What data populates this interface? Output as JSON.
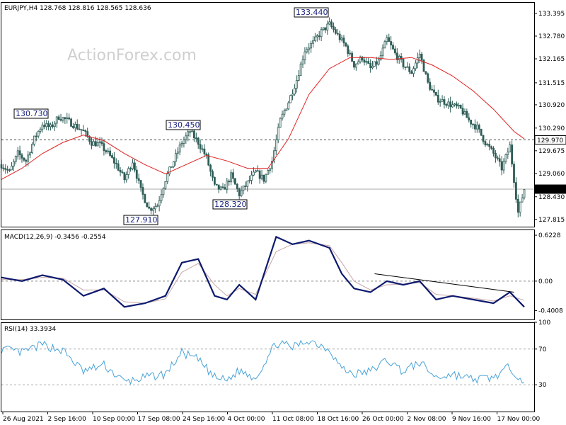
{
  "watermark": "ActionForex.com",
  "colors": {
    "candle": "#2e5d57",
    "ma": "#e02020",
    "macd": "#0d1a6e",
    "signal": "#c8a6a6",
    "rsi": "#4aa3d8",
    "trendline": "#000000",
    "level_box": "#000000"
  },
  "chart_data": [
    {
      "type": "candlestick",
      "title": "EURJPY,H4  128.768 128.816 128.565 128.636",
      "ylim": [
        127.62,
        133.7
      ],
      "y_ticks": [
        "133.395",
        "132.780",
        "132.165",
        "131.515",
        "130.920",
        "130.290",
        "129.675",
        "129.060",
        "128.430",
        "127.815"
      ],
      "x_ticks": [
        "26 Aug 2021",
        "2 Sep 16:00",
        "10 Sep 00:00",
        "17 Sep 08:00",
        "24 Sep 16:00",
        "4 Oct 00:00",
        "11 Oct 08:00",
        "18 Oct 16:00",
        "26 Oct 00:00",
        "2 Nov 08:00",
        "9 Nov 16:00",
        "17 Nov 00:00"
      ],
      "current_price": "128.636",
      "horizontal_level": "129.970",
      "annotations": [
        "130.730",
        "130.450",
        "127.910",
        "128.320",
        "133.440"
      ],
      "close_path": [
        {
          "x": 0,
          "y": 129.3
        },
        {
          "x": 4,
          "y": 129.1
        },
        {
          "x": 8,
          "y": 129.6
        },
        {
          "x": 12,
          "y": 129.4
        },
        {
          "x": 16,
          "y": 130.0
        },
        {
          "x": 20,
          "y": 130.4
        },
        {
          "x": 24,
          "y": 130.3
        },
        {
          "x": 28,
          "y": 130.6
        },
        {
          "x": 32,
          "y": 130.5
        },
        {
          "x": 36,
          "y": 130.35
        },
        {
          "x": 40,
          "y": 130.2
        },
        {
          "x": 44,
          "y": 129.9
        },
        {
          "x": 48,
          "y": 129.85
        },
        {
          "x": 52,
          "y": 129.6
        },
        {
          "x": 56,
          "y": 129.3
        },
        {
          "x": 60,
          "y": 128.9
        },
        {
          "x": 64,
          "y": 129.4
        },
        {
          "x": 68,
          "y": 128.6
        },
        {
          "x": 72,
          "y": 128.1
        },
        {
          "x": 76,
          "y": 128.2
        },
        {
          "x": 80,
          "y": 128.9
        },
        {
          "x": 84,
          "y": 129.4
        },
        {
          "x": 88,
          "y": 129.9
        },
        {
          "x": 92,
          "y": 130.2
        },
        {
          "x": 96,
          "y": 129.9
        },
        {
          "x": 100,
          "y": 129.5
        },
        {
          "x": 104,
          "y": 128.7
        },
        {
          "x": 108,
          "y": 128.6
        },
        {
          "x": 112,
          "y": 129.0
        },
        {
          "x": 116,
          "y": 128.5
        },
        {
          "x": 120,
          "y": 128.8
        },
        {
          "x": 124,
          "y": 129.1
        },
        {
          "x": 128,
          "y": 128.9
        },
        {
          "x": 132,
          "y": 129.4
        },
        {
          "x": 136,
          "y": 130.5
        },
        {
          "x": 140,
          "y": 131.0
        },
        {
          "x": 144,
          "y": 131.6
        },
        {
          "x": 148,
          "y": 132.4
        },
        {
          "x": 152,
          "y": 132.6
        },
        {
          "x": 156,
          "y": 132.9
        },
        {
          "x": 160,
          "y": 133.1
        },
        {
          "x": 164,
          "y": 132.8
        },
        {
          "x": 168,
          "y": 132.5
        },
        {
          "x": 172,
          "y": 132.0
        },
        {
          "x": 176,
          "y": 132.2
        },
        {
          "x": 180,
          "y": 131.9
        },
        {
          "x": 184,
          "y": 132.1
        },
        {
          "x": 188,
          "y": 132.7
        },
        {
          "x": 192,
          "y": 132.3
        },
        {
          "x": 196,
          "y": 132.0
        },
        {
          "x": 200,
          "y": 131.8
        },
        {
          "x": 204,
          "y": 132.3
        },
        {
          "x": 208,
          "y": 131.5
        },
        {
          "x": 212,
          "y": 131.1
        },
        {
          "x": 216,
          "y": 131.0
        },
        {
          "x": 220,
          "y": 130.9
        },
        {
          "x": 224,
          "y": 130.8
        },
        {
          "x": 228,
          "y": 130.5
        },
        {
          "x": 232,
          "y": 130.3
        },
        {
          "x": 236,
          "y": 129.9
        },
        {
          "x": 240,
          "y": 129.6
        },
        {
          "x": 244,
          "y": 129.2
        },
        {
          "x": 248,
          "y": 129.8
        },
        {
          "x": 252,
          "y": 128.0
        },
        {
          "x": 255,
          "y": 128.64
        }
      ],
      "moving_average": [
        {
          "x": 0,
          "y": 128.9
        },
        {
          "x": 10,
          "y": 129.2
        },
        {
          "x": 20,
          "y": 129.6
        },
        {
          "x": 30,
          "y": 129.9
        },
        {
          "x": 40,
          "y": 130.1
        },
        {
          "x": 50,
          "y": 129.95
        },
        {
          "x": 60,
          "y": 129.6
        },
        {
          "x": 70,
          "y": 129.3
        },
        {
          "x": 80,
          "y": 129.05
        },
        {
          "x": 90,
          "y": 129.3
        },
        {
          "x": 100,
          "y": 129.55
        },
        {
          "x": 110,
          "y": 129.4
        },
        {
          "x": 120,
          "y": 129.2
        },
        {
          "x": 130,
          "y": 129.2
        },
        {
          "x": 140,
          "y": 130.0
        },
        {
          "x": 150,
          "y": 131.2
        },
        {
          "x": 160,
          "y": 131.9
        },
        {
          "x": 170,
          "y": 132.2
        },
        {
          "x": 180,
          "y": 132.2
        },
        {
          "x": 190,
          "y": 132.15
        },
        {
          "x": 200,
          "y": 132.2
        },
        {
          "x": 210,
          "y": 132.0
        },
        {
          "x": 220,
          "y": 131.7
        },
        {
          "x": 230,
          "y": 131.3
        },
        {
          "x": 240,
          "y": 130.8
        },
        {
          "x": 250,
          "y": 130.2
        },
        {
          "x": 255,
          "y": 130.0
        }
      ]
    },
    {
      "type": "line",
      "title": "MACD(12,26,9) -0.3456 -0.2554",
      "ylim": [
        -0.52,
        0.7
      ],
      "y_ticks": [
        "0.6228",
        "0.00",
        "-0.4008"
      ],
      "series": [
        {
          "values": [
            {
              "x": 0,
              "y": 0.05
            },
            {
              "x": 10,
              "y": 0.0
            },
            {
              "x": 20,
              "y": 0.08
            },
            {
              "x": 30,
              "y": 0.02
            },
            {
              "x": 40,
              "y": -0.2
            },
            {
              "x": 50,
              "y": -0.1
            },
            {
              "x": 60,
              "y": -0.35
            },
            {
              "x": 70,
              "y": -0.3
            },
            {
              "x": 80,
              "y": -0.2
            },
            {
              "x": 88,
              "y": 0.25
            },
            {
              "x": 96,
              "y": 0.3
            },
            {
              "x": 104,
              "y": -0.2
            },
            {
              "x": 110,
              "y": -0.25
            },
            {
              "x": 116,
              "y": -0.05
            },
            {
              "x": 124,
              "y": -0.25
            },
            {
              "x": 134,
              "y": 0.6
            },
            {
              "x": 142,
              "y": 0.5
            },
            {
              "x": 150,
              "y": 0.55
            },
            {
              "x": 160,
              "y": 0.45
            },
            {
              "x": 166,
              "y": 0.1
            },
            {
              "x": 172,
              "y": -0.1
            },
            {
              "x": 180,
              "y": -0.15
            },
            {
              "x": 188,
              "y": 0.0
            },
            {
              "x": 196,
              "y": -0.05
            },
            {
              "x": 204,
              "y": -0.0
            },
            {
              "x": 212,
              "y": -0.25
            },
            {
              "x": 220,
              "y": -0.2
            },
            {
              "x": 230,
              "y": -0.25
            },
            {
              "x": 240,
              "y": -0.3
            },
            {
              "x": 248,
              "y": -0.15
            },
            {
              "x": 255,
              "y": -0.35
            }
          ]
        },
        {
          "values": [
            {
              "x": 0,
              "y": 0.02
            },
            {
              "x": 10,
              "y": 0.02
            },
            {
              "x": 20,
              "y": 0.05
            },
            {
              "x": 30,
              "y": 0.04
            },
            {
              "x": 40,
              "y": -0.12
            },
            {
              "x": 50,
              "y": -0.12
            },
            {
              "x": 60,
              "y": -0.28
            },
            {
              "x": 70,
              "y": -0.3
            },
            {
              "x": 80,
              "y": -0.24
            },
            {
              "x": 88,
              "y": 0.12
            },
            {
              "x": 96,
              "y": 0.24
            },
            {
              "x": 104,
              "y": -0.05
            },
            {
              "x": 110,
              "y": -0.2
            },
            {
              "x": 116,
              "y": -0.1
            },
            {
              "x": 124,
              "y": -0.18
            },
            {
              "x": 134,
              "y": 0.4
            },
            {
              "x": 142,
              "y": 0.5
            },
            {
              "x": 150,
              "y": 0.52
            },
            {
              "x": 160,
              "y": 0.48
            },
            {
              "x": 166,
              "y": 0.25
            },
            {
              "x": 172,
              "y": 0.0
            },
            {
              "x": 180,
              "y": -0.12
            },
            {
              "x": 188,
              "y": -0.05
            },
            {
              "x": 196,
              "y": -0.04
            },
            {
              "x": 204,
              "y": -0.02
            },
            {
              "x": 212,
              "y": -0.18
            },
            {
              "x": 220,
              "y": -0.2
            },
            {
              "x": 230,
              "y": -0.23
            },
            {
              "x": 240,
              "y": -0.27
            },
            {
              "x": 248,
              "y": -0.2
            },
            {
              "x": 255,
              "y": -0.26
            }
          ]
        }
      ],
      "trendline": [
        {
          "x": 182,
          "y": 0.1
        },
        {
          "x": 250,
          "y": -0.15
        }
      ]
    },
    {
      "type": "line",
      "title": "RSI(14) 33.3934",
      "ylim": [
        0,
        100
      ],
      "y_ticks": [
        "100",
        "70",
        "30"
      ],
      "levels": [
        70,
        30
      ],
      "series": [
        {
          "values": [
            {
              "x": 0,
              "y": 70
            },
            {
              "x": 10,
              "y": 66
            },
            {
              "x": 20,
              "y": 75
            },
            {
              "x": 30,
              "y": 68
            },
            {
              "x": 40,
              "y": 45
            },
            {
              "x": 50,
              "y": 52
            },
            {
              "x": 60,
              "y": 33
            },
            {
              "x": 70,
              "y": 38
            },
            {
              "x": 80,
              "y": 42
            },
            {
              "x": 88,
              "y": 66
            },
            {
              "x": 96,
              "y": 58
            },
            {
              "x": 104,
              "y": 38
            },
            {
              "x": 110,
              "y": 35
            },
            {
              "x": 116,
              "y": 46
            },
            {
              "x": 124,
              "y": 38
            },
            {
              "x": 134,
              "y": 77
            },
            {
              "x": 142,
              "y": 72
            },
            {
              "x": 150,
              "y": 80
            },
            {
              "x": 160,
              "y": 70
            },
            {
              "x": 166,
              "y": 48
            },
            {
              "x": 172,
              "y": 42
            },
            {
              "x": 180,
              "y": 45
            },
            {
              "x": 188,
              "y": 58
            },
            {
              "x": 196,
              "y": 45
            },
            {
              "x": 204,
              "y": 55
            },
            {
              "x": 212,
              "y": 38
            },
            {
              "x": 220,
              "y": 42
            },
            {
              "x": 230,
              "y": 36
            },
            {
              "x": 240,
              "y": 38
            },
            {
              "x": 248,
              "y": 50
            },
            {
              "x": 255,
              "y": 33
            }
          ]
        }
      ]
    }
  ]
}
